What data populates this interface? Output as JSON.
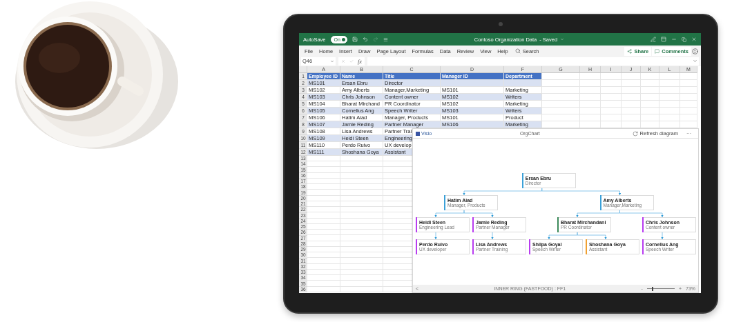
{
  "title_bar": {
    "autosave_label": "AutoSave",
    "autosave": {
      "text": "On",
      "on": true
    },
    "title": "Contoso Organization Data",
    "status": "- Saved"
  },
  "menu": {
    "tabs": [
      "File",
      "Home",
      "Insert",
      "Draw",
      "Page Layout",
      "Formulas",
      "Data",
      "Review",
      "View",
      "Help"
    ],
    "search": "Search",
    "share": "Share",
    "comments": "Comments"
  },
  "formula_bar": {
    "name_box": "Q46",
    "fx": "fx"
  },
  "sheet": {
    "columns": [
      "A",
      "B",
      "C",
      "D",
      "F",
      "G",
      "H",
      "I",
      "J",
      "K",
      "L",
      "M"
    ],
    "row_numbers": [
      "1",
      "2",
      "3",
      "4",
      "5",
      "6",
      "7",
      "8",
      "9",
      "10",
      "11",
      "12",
      "13",
      "14",
      "15",
      "16",
      "17",
      "18",
      "19",
      "20",
      "21",
      "22",
      "23",
      "24",
      "25",
      "26",
      "27",
      "28",
      "29",
      "30",
      "31",
      "32",
      "33",
      "34",
      "35",
      "36"
    ],
    "rows": [
      {
        "kind": "header",
        "cells": [
          "Employee ID",
          "Name",
          "Title",
          "Manager ID",
          "Department"
        ]
      },
      {
        "kind": "data",
        "cells": [
          "MS101",
          "Ersan Ebru",
          "Director",
          null,
          null
        ]
      },
      {
        "kind": "data",
        "cells": [
          "MS102",
          "Amy Alberts",
          "Manager,Marketing",
          "MS101",
          "Marketing"
        ]
      },
      {
        "kind": "data",
        "cells": [
          "MS103",
          "Chris Johnson",
          "Content owner",
          "MS102",
          "Writers"
        ]
      },
      {
        "kind": "data",
        "cells": [
          "MS104",
          "Bharat Mirchand",
          "PR Coordinator",
          "MS102",
          "Marketing"
        ]
      },
      {
        "kind": "data",
        "cells": [
          "MS105",
          "Cornelius Ang",
          "Speech Writer",
          "MS103",
          "Writers"
        ]
      },
      {
        "kind": "data",
        "cells": [
          "MS106",
          "Hatim Aiad",
          "Manager, Products",
          "MS101",
          "Product"
        ]
      },
      {
        "kind": "data",
        "cells": [
          "MS107",
          "Jamie Reding",
          "Partner Manager",
          "MS106",
          "Marketing"
        ]
      },
      {
        "kind": "data",
        "cells": [
          "MS108",
          "Lisa Andrews",
          "Partner Trai"
        ]
      },
      {
        "kind": "data",
        "cells": [
          "MS109",
          "Heidi Steen",
          "Engineering"
        ]
      },
      {
        "kind": "data",
        "cells": [
          "MS110",
          "Perdo Ruivo",
          "UX develop"
        ]
      },
      {
        "kind": "data",
        "cells": [
          "MS111",
          "Shoshana Goya",
          "Assistant"
        ]
      }
    ]
  },
  "visio_panel": {
    "app_label": "Visio",
    "title": "OrgChart",
    "refresh": "Refresh diagram",
    "more": "···",
    "org_chart": {
      "name": "Ersan Ebru",
      "title": "Director",
      "color": "#3aa0d8",
      "children": [
        {
          "name": "Hatim Aiad",
          "title": "Manager, Products",
          "color": "#3aa0d8",
          "children": [
            {
              "name": "Heidi Steen",
              "title": "Engineering Lead",
              "color": "#b83cf0",
              "children": [
                {
                  "name": "Perdo Ruivo",
                  "title": "UX developer",
                  "color": "#b83cf0"
                }
              ]
            },
            {
              "name": "Jamie Reding",
              "title": "Partner Manager",
              "color": "#b83cf0",
              "children": [
                {
                  "name": "Lisa Andrews",
                  "title": "Partner Training",
                  "color": "#b83cf0"
                }
              ]
            }
          ]
        },
        {
          "name": "Amy Alberts",
          "title": "Manager,Marketing",
          "color": "#3aa0d8",
          "children": [
            {
              "name": "Bharat Mirchandani",
              "title": "PR Coordinator",
              "color": "#3c8a5a",
              "children": [
                {
                  "name": "Shilpa Goyal",
                  "title": "Speech Writer",
                  "color": "#b83cf0"
                },
                {
                  "name": "Shoshana Goya",
                  "title": "Assistant",
                  "color": "#f0a030"
                }
              ]
            },
            {
              "name": "Chris Johnson",
              "title": "Content owner",
              "color": "#b83cf0",
              "children": [
                {
                  "name": "Cornelius Ang",
                  "title": "Speech Writer",
                  "color": "#b83cf0"
                }
              ]
            }
          ]
        }
      ]
    },
    "status_bar": {
      "scroll_left": "<",
      "text": "INNER RING (FASTFOOD) : FF1",
      "zoom_out": "-",
      "zoom": {
        "level": 0.2
      },
      "zoom_in": "+",
      "zoom_text": "73%"
    }
  }
}
